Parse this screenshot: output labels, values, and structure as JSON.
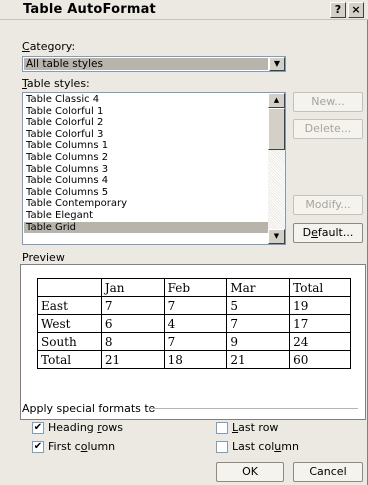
{
  "dialog": {
    "title": "Table AutoFormat",
    "help_glyph": "?",
    "close_glyph": "×"
  },
  "category": {
    "label_key": "C",
    "label_rest": "ategory:",
    "value": "All table styles"
  },
  "table_styles": {
    "label_key": "T",
    "label_rest": "able styles:",
    "items": [
      "Table Classic 4",
      "Table Colorful 1",
      "Table Colorful 2",
      "Table Colorful 3",
      "Table Columns 1",
      "Table Columns 2",
      "Table Columns 3",
      "Table Columns 4",
      "Table Columns 5",
      "Table Contemporary",
      "Table Elegant",
      "Table Grid"
    ],
    "selected_index": 11
  },
  "buttons": {
    "new": "New...",
    "delete": "Delete...",
    "modify": "Modify...",
    "default_pre": "D",
    "default_key": "e",
    "default_post": "fault...",
    "ok": "OK",
    "cancel": "Cancel"
  },
  "preview": {
    "label": "Preview",
    "rows": [
      [
        "",
        "Jan",
        "Feb",
        "Mar",
        "Total"
      ],
      [
        "East",
        "7",
        "7",
        "5",
        "19"
      ],
      [
        "West",
        "6",
        "4",
        "7",
        "17"
      ],
      [
        "South",
        "8",
        "7",
        "9",
        "24"
      ],
      [
        "Total",
        "21",
        "18",
        "21",
        "60"
      ]
    ]
  },
  "special_formats": {
    "label": "Apply special formats to",
    "heading_rows": {
      "pre": "Heading ",
      "key": "r",
      "post": "ows",
      "checked": true
    },
    "first_column": {
      "pre": "First c",
      "key": "o",
      "post": "lumn",
      "checked": true
    },
    "last_row": {
      "pre": "",
      "key": "L",
      "post": "ast row",
      "checked": false
    },
    "last_column": {
      "pre": "Last col",
      "key": "u",
      "post": "mn",
      "checked": false
    }
  }
}
